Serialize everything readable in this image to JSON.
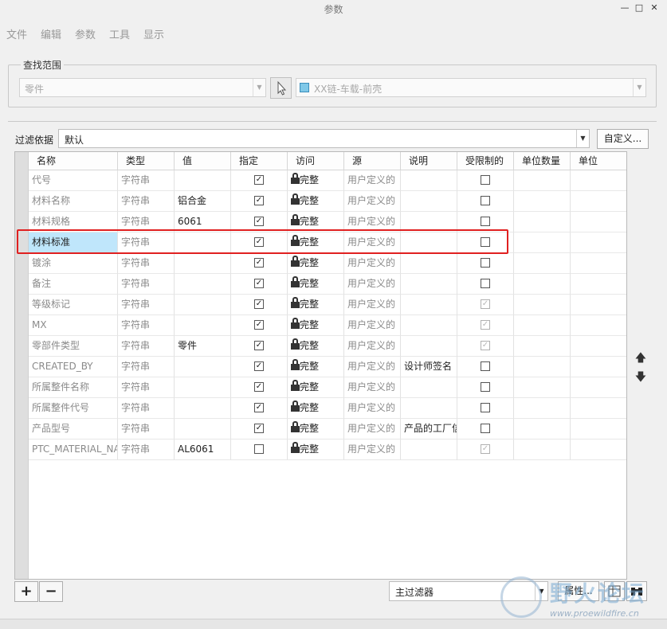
{
  "window": {
    "title": "参数",
    "controls": [
      "—",
      "□",
      "✕"
    ]
  },
  "menu": [
    "文件",
    "编辑",
    "参数",
    "工具",
    "显示"
  ],
  "search_scope": {
    "legend": "查找范围",
    "type_value": "零件",
    "model_value": "XX链-车载-前壳"
  },
  "filter": {
    "label": "过滤依据",
    "value": "默认",
    "custom_button": "自定义..."
  },
  "table": {
    "columns": [
      "名称",
      "类型",
      "值",
      "指定",
      "访问",
      "源",
      "说明",
      "受限制的",
      "单位数量",
      "单位"
    ],
    "rows": [
      {
        "name": "代号",
        "type": "字符串",
        "value": "",
        "designate": true,
        "access": "完整",
        "source": "用户定义的",
        "desc": "",
        "restricted": false,
        "restricted_disabled": false
      },
      {
        "name": "材料名称",
        "type": "字符串",
        "value": "铝合金",
        "designate": true,
        "access": "完整",
        "source": "用户定义的",
        "desc": "",
        "restricted": false,
        "restricted_disabled": false
      },
      {
        "name": "材料规格",
        "type": "字符串",
        "value": "6061",
        "designate": true,
        "access": "完整",
        "source": "用户定义的",
        "desc": "",
        "restricted": false,
        "restricted_disabled": false
      },
      {
        "name": "材料标准",
        "type": "字符串",
        "value": "",
        "designate": true,
        "access": "完整",
        "source": "用户定义的",
        "desc": "",
        "restricted": false,
        "restricted_disabled": false,
        "selected": true
      },
      {
        "name": "镀涂",
        "type": "字符串",
        "value": "",
        "designate": true,
        "access": "完整",
        "source": "用户定义的",
        "desc": "",
        "restricted": false,
        "restricted_disabled": false
      },
      {
        "name": "备注",
        "type": "字符串",
        "value": "",
        "designate": true,
        "access": "完整",
        "source": "用户定义的",
        "desc": "",
        "restricted": false,
        "restricted_disabled": false
      },
      {
        "name": "等级标记",
        "type": "字符串",
        "value": "",
        "designate": true,
        "access": "完整",
        "source": "用户定义的",
        "desc": "",
        "restricted": true,
        "restricted_disabled": true
      },
      {
        "name": "MX",
        "type": "字符串",
        "value": "",
        "designate": true,
        "access": "完整",
        "source": "用户定义的",
        "desc": "",
        "restricted": true,
        "restricted_disabled": true
      },
      {
        "name": "零部件类型",
        "type": "字符串",
        "value": "零件",
        "designate": true,
        "access": "完整",
        "source": "用户定义的",
        "desc": "",
        "restricted": true,
        "restricted_disabled": true
      },
      {
        "name": "CREATED_BY",
        "type": "字符串",
        "value": "",
        "designate": true,
        "access": "完整",
        "source": "用户定义的",
        "desc": "设计师签名",
        "restricted": false,
        "restricted_disabled": false
      },
      {
        "name": "所属整件名称",
        "type": "字符串",
        "value": "",
        "designate": true,
        "access": "完整",
        "source": "用户定义的",
        "desc": "",
        "restricted": false,
        "restricted_disabled": false
      },
      {
        "name": "所属整件代号",
        "type": "字符串",
        "value": "",
        "designate": true,
        "access": "完整",
        "source": "用户定义的",
        "desc": "",
        "restricted": false,
        "restricted_disabled": false
      },
      {
        "name": "产品型号",
        "type": "字符串",
        "value": "",
        "designate": true,
        "access": "完整",
        "source": "用户定义的",
        "desc": "产品的工厂信",
        "restricted": false,
        "restricted_disabled": false
      },
      {
        "name": "PTC_MATERIAL_NAME",
        "type": "字符串",
        "value": "AL6061",
        "designate": false,
        "access": "完整",
        "source": "用户定义的",
        "desc": "",
        "restricted": true,
        "restricted_disabled": true
      }
    ]
  },
  "bottom": {
    "add": "+",
    "remove": "−",
    "main_filter": "主过滤器",
    "properties": "属性..."
  },
  "watermark": {
    "logo": "野火论坛",
    "url": "www.proewildfire.cn"
  },
  "colors": {
    "selected_row": "#bfe6fb",
    "highlight_box": "#e02020"
  }
}
